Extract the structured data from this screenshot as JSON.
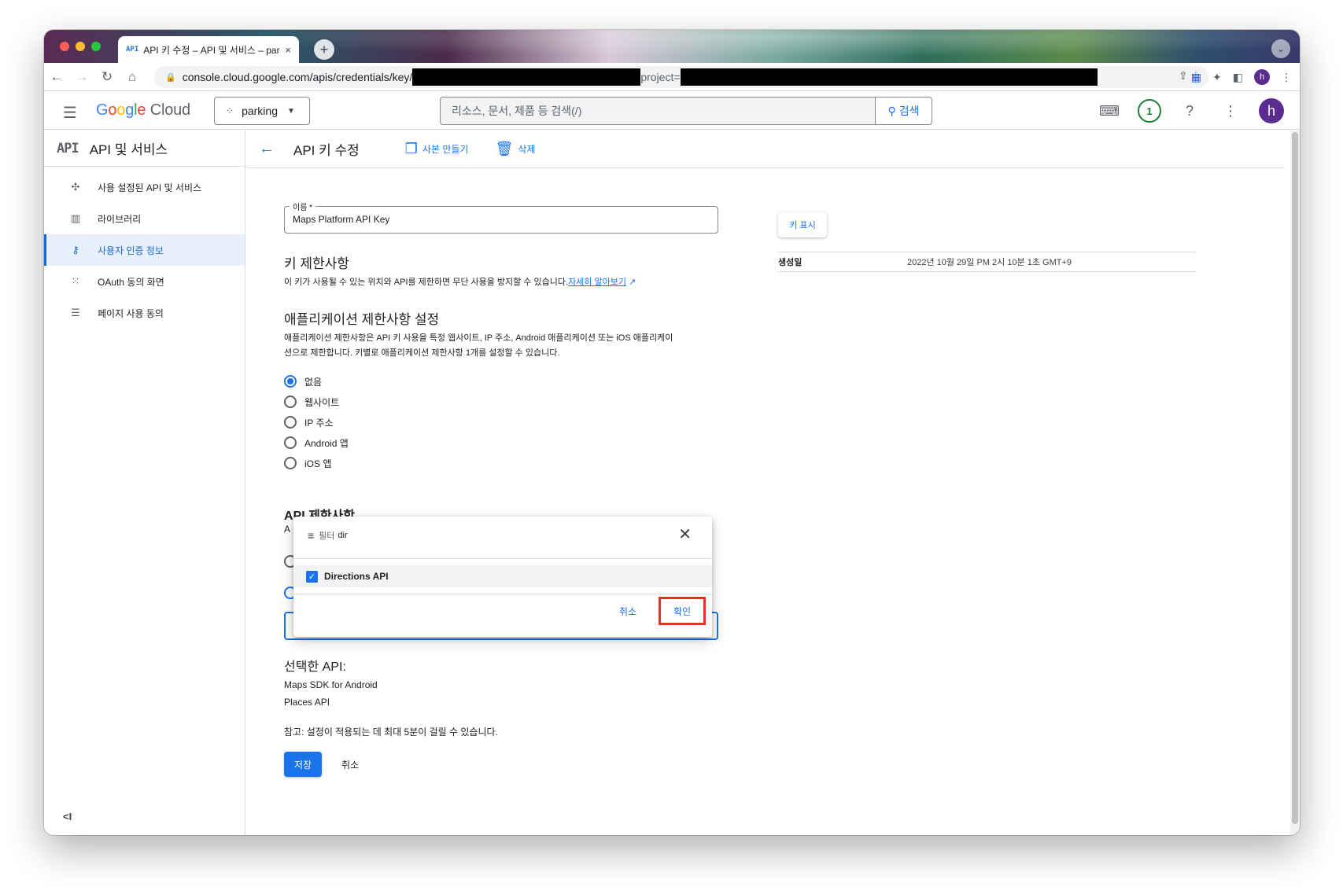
{
  "browser": {
    "tab_icon": "API",
    "tab_title": "API 키 수정 – API 및 서비스 – park",
    "tab_close": "×",
    "new_tab": "+",
    "url_prefix": "console.cloud.google.com/apis/credentials/key/",
    "url_mid": "project="
  },
  "header": {
    "logo_google": [
      "G",
      "o",
      "o",
      "g",
      "l",
      "e"
    ],
    "logo_google_colors": [
      "#4285f4",
      "#ea4335",
      "#fbbc05",
      "#4285f4",
      "#34a853",
      "#ea4335"
    ],
    "logo_cloud": "Cloud",
    "project": "parking",
    "search_placeholder": "리소스, 문서, 제품 등 검색(/)",
    "search_button": "검색",
    "notification_count": "1",
    "avatar_letter": "h"
  },
  "sidebar": {
    "api_badge": "API",
    "title": "API 및 서비스",
    "items": [
      {
        "label": "사용 설정된 API 및 서비스",
        "icon": "diamond-nodes-icon"
      },
      {
        "label": "라이브러리",
        "icon": "library-icon"
      },
      {
        "label": "사용자 인증 정보",
        "icon": "key-icon",
        "active": true
      },
      {
        "label": "OAuth 동의 화면",
        "icon": "dots-grid-icon"
      },
      {
        "label": "페이지 사용 동의",
        "icon": "settings-list-icon"
      }
    ],
    "collapse": "<I"
  },
  "page": {
    "title": "API 키 수정",
    "action_copy": "사본 만들기",
    "action_delete": "삭제",
    "name_label": "이름 *",
    "name_value": "Maps Platform API Key",
    "key_restrictions_title": "키 제한사항",
    "key_restrictions_desc": "이 키가 사용될 수 있는 위치와 API를 제한하면 무단 사용을 방지할 수 있습니다.",
    "learn_more": "자세히 알아보기",
    "app_restrictions_title": "애플리케이션 제한사항 설정",
    "app_restrictions_desc1": "애플리케이션 제한사항은 API 키 사용을 특정 웹사이트, IP 주소, Android 애플리케이션 또는 iOS 애플리케이",
    "app_restrictions_desc2": "션으로 제한합니다. 키별로 애플리케이션 제한사항 1개를 설정할 수 있습니다.",
    "app_options": [
      "없음",
      "웹사이트",
      "IP 주소",
      "Android 앱",
      "iOS 앱"
    ],
    "app_selected": "없음",
    "api_restrictions_title": "API 제한사항",
    "api_restrictions_stub": "A",
    "selected_api_label": "선택한 API:",
    "selected_apis": [
      "Maps SDK for Android",
      "Places API"
    ],
    "note": "참고: 설정이 적용되는 데 최대 5분이 걸릴 수 있습니다.",
    "save": "저장",
    "cancel": "취소",
    "show_key": "키 표시",
    "created_label": "생성일",
    "created_value": "2022년 10월 29일 PM 2시 10분 1초 GMT+9"
  },
  "popup": {
    "filter_label": "필터",
    "filter_query": "dir",
    "option": "Directions API",
    "option_checked": true,
    "cancel": "취소",
    "ok": "확인"
  }
}
